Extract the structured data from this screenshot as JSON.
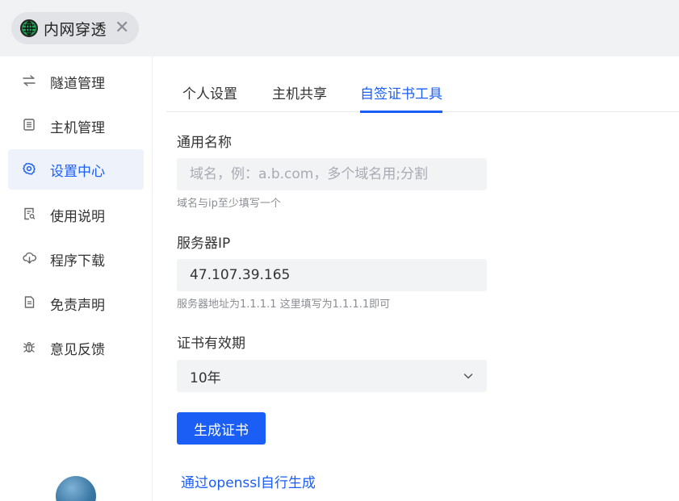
{
  "app_tab": {
    "label": "内网穿透",
    "close": "✕"
  },
  "sidebar": {
    "items": [
      {
        "label": "隧道管理",
        "icon": "swap-arrows-icon",
        "active": false
      },
      {
        "label": "主机管理",
        "icon": "server-list-icon",
        "active": false
      },
      {
        "label": "设置中心",
        "icon": "gear-icon",
        "active": true
      },
      {
        "label": "使用说明",
        "icon": "doc-search-icon",
        "active": false
      },
      {
        "label": "程序下载",
        "icon": "cloud-download-icon",
        "active": false
      },
      {
        "label": "免责声明",
        "icon": "file-icon",
        "active": false
      },
      {
        "label": "意见反馈",
        "icon": "bug-icon",
        "active": false
      }
    ]
  },
  "tabs": [
    {
      "label": "个人设置",
      "active": false
    },
    {
      "label": "主机共享",
      "active": false
    },
    {
      "label": "自签证书工具",
      "active": true
    }
  ],
  "form": {
    "common_name": {
      "label": "通用名称",
      "value": "",
      "placeholder": "域名，例：a.b.com，多个域名用;分割",
      "hint": "域名与ip至少填写一个"
    },
    "server_ip": {
      "label": "服务器IP",
      "value": "47.107.39.165",
      "placeholder": "",
      "hint": "服务器地址为1.1.1.1 这里填写为1.1.1.1即可"
    },
    "validity": {
      "label": "证书有效期",
      "selected": "10年"
    },
    "submit_label": "生成证书",
    "openssl_link": "通过openssl自行生成"
  },
  "colors": {
    "accent": "#1b5ef5",
    "input_bg": "#f2f3f5",
    "topbar_bg": "#f1f2f4"
  }
}
